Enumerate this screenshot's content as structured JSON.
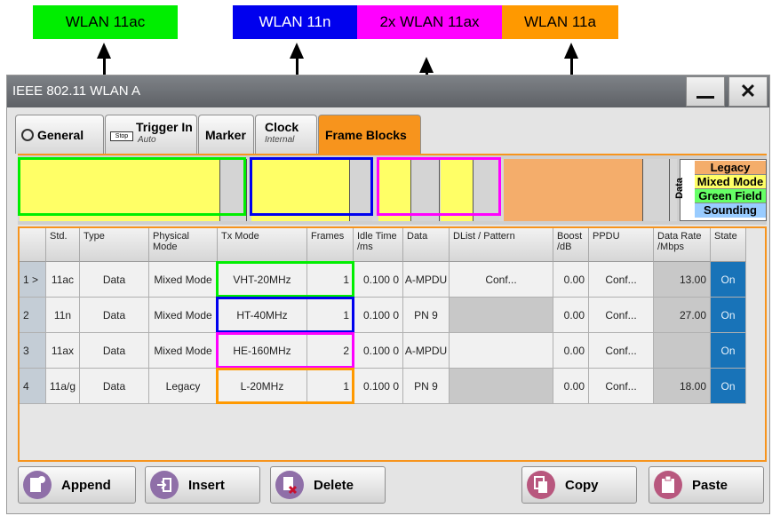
{
  "annotations": [
    {
      "label": "WLAN 11ac",
      "color": "#00ee00",
      "text_color": "#000000"
    },
    {
      "label": "WLAN 11n",
      "color": "#0000ee",
      "text_color": "#ffffff"
    },
    {
      "label": "2x WLAN 11ax",
      "color": "#ff00ff",
      "text_color": "#000000"
    },
    {
      "label": "WLAN 11a",
      "color": "#ff9900",
      "text_color": "#000000"
    }
  ],
  "window": {
    "title": "IEEE 802.11 WLAN A",
    "minimize_icon": "minimize-icon",
    "close_icon": "close-icon",
    "close_symbol": "✕"
  },
  "tabs": [
    {
      "label": "General",
      "sub": "",
      "icon": "gear-icon"
    },
    {
      "label": "Trigger In",
      "sub": "Auto",
      "icon": "stop-icon",
      "icon_text": "Stop"
    },
    {
      "label": "Marker",
      "sub": ""
    },
    {
      "label": "Clock",
      "sub": "Internal"
    },
    {
      "label": "Frame Blocks",
      "sub": "",
      "active": true
    }
  ],
  "legend": {
    "title": "Data",
    "items": [
      {
        "label": "Legacy",
        "color": "#f4ad6b"
      },
      {
        "label": "Mixed Mode",
        "color": "#ffff66"
      },
      {
        "label": "Green Field",
        "color": "#66ff66"
      },
      {
        "label": "Sounding",
        "color": "#99ccff"
      }
    ]
  },
  "table": {
    "headers": [
      "",
      "Std.",
      "Type",
      "Physical Mode",
      "Tx Mode",
      "Frames",
      "Idle Time /ms",
      "Data",
      "DList / Pattern",
      "Boost /dB",
      "PPDU",
      "Data Rate /Mbps",
      "State"
    ],
    "rows": [
      [
        "1 >",
        "11ac",
        "Data",
        "Mixed Mode",
        "VHT-20MHz",
        "1",
        "0.100 0",
        "A-MPDU",
        "Conf...",
        "0.00",
        "Conf...",
        "13.00",
        "On"
      ],
      [
        "2",
        "11n",
        "Data",
        "Mixed Mode",
        "HT-40MHz",
        "1",
        "0.100 0",
        "PN 9",
        "",
        "0.00",
        "Conf...",
        "27.00",
        "On"
      ],
      [
        "3",
        "11ax",
        "Data",
        "Mixed Mode",
        "HE-160MHz",
        "2",
        "0.100 0",
        "A-MPDU",
        "",
        "0.00",
        "Conf...",
        "",
        "On"
      ],
      [
        "4",
        "11a/g",
        "Data",
        "Legacy",
        "L-20MHz",
        "1",
        "0.100 0",
        "PN 9",
        "",
        "0.00",
        "Conf...",
        "18.00",
        "On"
      ]
    ],
    "highlight_colors": [
      "#00ee00",
      "#0000ee",
      "#ff00ff",
      "#ff9900"
    ]
  },
  "buttons": [
    {
      "label": "Append",
      "icon": "append-icon"
    },
    {
      "label": "Insert",
      "icon": "insert-icon"
    },
    {
      "label": "Delete",
      "icon": "delete-icon"
    },
    {
      "label": "Copy",
      "icon": "copy-icon"
    },
    {
      "label": "Paste",
      "icon": "paste-icon"
    }
  ],
  "colors": {
    "accent": "#f7941d",
    "mixed_mode_fill": "#ffff66",
    "legacy_fill": "#f4ad6b",
    "state_on": "#1873b8"
  }
}
